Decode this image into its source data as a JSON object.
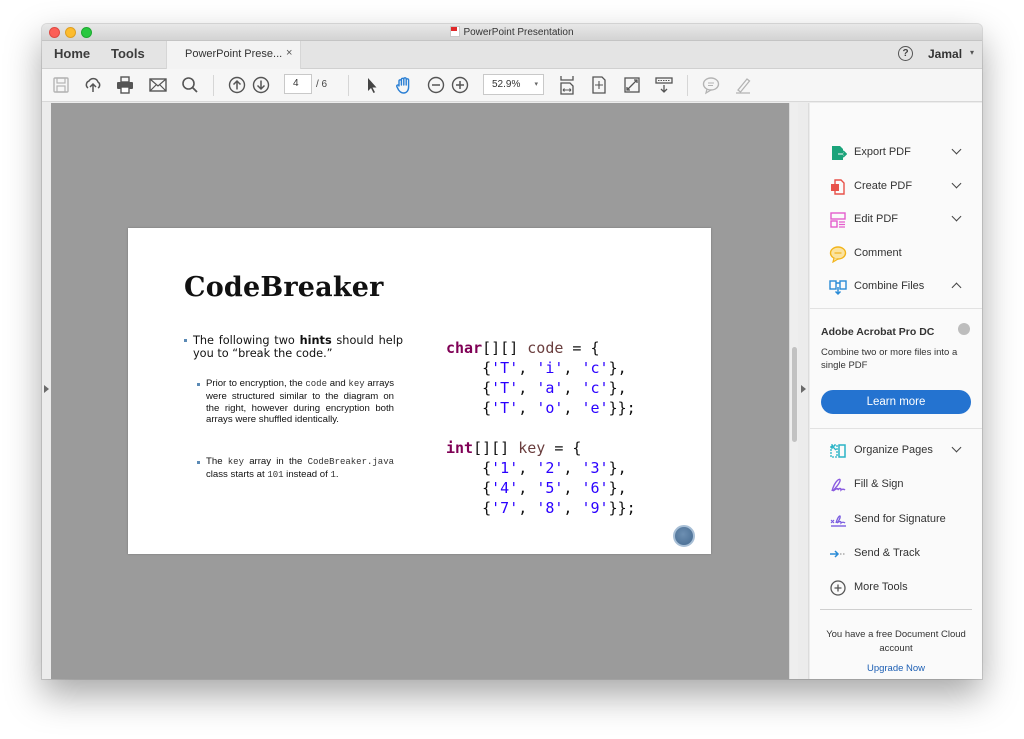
{
  "window": {
    "title": "PowerPoint Presentation"
  },
  "tabbar": {
    "home_label": "Home",
    "tools_label": "Tools",
    "document_tab_label": "PowerPoint Prese...",
    "close_glyph": "×",
    "help_glyph": "?",
    "user_name": "Jamal",
    "user_caret": "▾"
  },
  "toolbar": {
    "icons": [
      "save-icon",
      "upload-cloud-icon",
      "print-icon",
      "email-icon",
      "search-icon",
      "previous-page-icon",
      "next-page-icon",
      "select-pointer-icon",
      "hand-tool-icon",
      "zoom-out-icon",
      "zoom-in-icon",
      "fit-width-icon",
      "fit-page-icon",
      "full-screen-icon",
      "scroll-mode-icon",
      "comment-icon",
      "highlight-pen-icon"
    ],
    "current_page": "4",
    "page_total": "/ 6",
    "zoom_value": "52.9%",
    "zoom_caret": "▾"
  },
  "slide": {
    "title": "CodeBreaker",
    "bullet_main_pre": "The following two ",
    "bullet_main_bold": "hints",
    "bullet_main_post": " should help you to “break the code.”",
    "sub1_a": "Prior to encryption, the ",
    "sub1_code": "code",
    "sub1_b": " and ",
    "sub1_key": "key",
    "sub1_c": " arrays were structured similar to the diagram on the right, however during encryption both arrays were shuffled identically.",
    "sub2_a": "The ",
    "sub2_key": "key",
    "sub2_b": " array in the ",
    "sub2_class": "CodeBreaker.java",
    "sub2_c": " class starts at ",
    "sub2_num1": "101",
    "sub2_d": " instead of ",
    "sub2_num2": "1",
    "sub2_e": ".",
    "code_block_1": {
      "type_kw": "char",
      "brackets": "[][] ",
      "var": "code",
      "assign": " = {",
      "rows": [
        [
          "'T'",
          "'i'",
          "'c'"
        ],
        [
          "'T'",
          "'a'",
          "'c'"
        ],
        [
          "'T'",
          "'o'",
          "'e'"
        ]
      ]
    },
    "code_block_2": {
      "type_kw": "int",
      "brackets": "[][] ",
      "var": "key",
      "assign": " = {",
      "rows": [
        [
          "'1'",
          "'2'",
          "'3'"
        ],
        [
          "'4'",
          "'5'",
          "'6'"
        ],
        [
          "'7'",
          "'8'",
          "'9'"
        ]
      ]
    }
  },
  "sidebar": {
    "tools": [
      {
        "label": "Export PDF",
        "icon": "export-pdf-icon",
        "color": "#1aa37a",
        "expand": "down"
      },
      {
        "label": "Create PDF",
        "icon": "create-pdf-icon",
        "color": "#e8524a",
        "expand": "down"
      },
      {
        "label": "Edit PDF",
        "icon": "edit-pdf-icon",
        "color": "#e45ccc",
        "expand": "down"
      },
      {
        "label": "Comment",
        "icon": "comment-icon",
        "color": "#f2b41b",
        "expand": "none"
      },
      {
        "label": "Combine Files",
        "icon": "combine-files-icon",
        "color": "#2a8bd6",
        "expand": "up"
      }
    ],
    "promo": {
      "title": "Adobe Acrobat Pro DC",
      "description": "Combine two or more files into a single PDF",
      "button_label": "Learn more",
      "button_color": "#2473d0"
    },
    "more_tools": [
      {
        "label": "Organize Pages",
        "icon": "organize-pages-icon",
        "color": "#2ab3c6",
        "expand": "down"
      },
      {
        "label": "Fill & Sign",
        "icon": "fill-sign-icon",
        "color": "#8a5be0",
        "expand": "none"
      },
      {
        "label": "Send for Signature",
        "icon": "send-signature-icon",
        "color": "#7b5de0",
        "expand": "none"
      },
      {
        "label": "Send & Track",
        "icon": "send-track-icon",
        "color": "#2a8bd6",
        "expand": "none"
      },
      {
        "label": "More Tools",
        "icon": "more-tools-icon",
        "color": "#555555",
        "expand": "none"
      }
    ],
    "cloud_note": "You have a free Document Cloud account",
    "upgrade_link": "Upgrade Now"
  }
}
